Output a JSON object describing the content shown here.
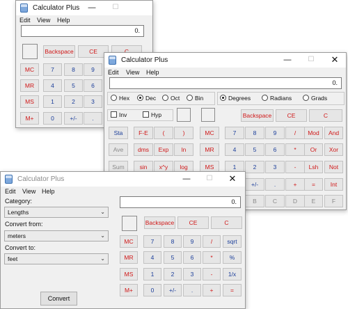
{
  "app_title": "Calculator Plus",
  "caption": {
    "min": "—",
    "max": "☐",
    "close": "✕"
  },
  "menu": {
    "edit": "Edit",
    "view": "View",
    "help": "Help"
  },
  "win1": {
    "display": "0.",
    "row0": [
      "Backspace",
      "CE",
      "C"
    ],
    "mem": [
      "MC",
      "MR",
      "MS",
      "M+"
    ],
    "rows": [
      [
        "7",
        "8",
        "9"
      ],
      [
        "4",
        "5",
        "6"
      ],
      [
        "1",
        "2",
        "3"
      ],
      [
        "0",
        "+/-",
        "."
      ]
    ]
  },
  "win2": {
    "display": "0.",
    "bases": [
      "Hex",
      "Dec",
      "Oct",
      "Bin"
    ],
    "angles": [
      "Degrees",
      "Radians",
      "Grads"
    ],
    "inv": "Inv",
    "hyp": "Hyp",
    "row0": [
      "Backspace",
      "CE",
      "C"
    ],
    "sci_left": [
      [
        "Sta",
        "F-E",
        "(",
        ")"
      ],
      [
        "Ave",
        "dms",
        "Exp",
        "ln"
      ],
      [
        "Sum",
        "sin",
        "x^y",
        "log"
      ]
    ],
    "mem": [
      "MC",
      "MR",
      "MS"
    ],
    "digits": [
      [
        "7",
        "8",
        "9",
        "/",
        "Mod",
        "And"
      ],
      [
        "4",
        "5",
        "6",
        "*",
        "Or",
        "Xor"
      ],
      [
        "1",
        "2",
        "3",
        "-",
        "Lsh",
        "Not"
      ],
      [
        "+/-",
        ".",
        "+",
        "=",
        "Int"
      ],
      [
        "B",
        "C",
        "D",
        "E",
        "F"
      ]
    ]
  },
  "win3": {
    "display": "0.",
    "category_label": "Category:",
    "category_value": "Lengths",
    "from_label": "Convert from:",
    "from_value": "meters",
    "to_label": "Convert to:",
    "to_value": "feet",
    "convert": "Convert",
    "row0": [
      "Backspace",
      "CE",
      "C"
    ],
    "mem": [
      "MC",
      "MR",
      "MS",
      "M+"
    ],
    "rows": [
      [
        "7",
        "8",
        "9",
        "/",
        "sqrt"
      ],
      [
        "4",
        "5",
        "6",
        "*",
        "%"
      ],
      [
        "1",
        "2",
        "3",
        "-",
        "1/x"
      ],
      [
        "0",
        "+/-",
        ".",
        "+",
        "="
      ]
    ]
  }
}
